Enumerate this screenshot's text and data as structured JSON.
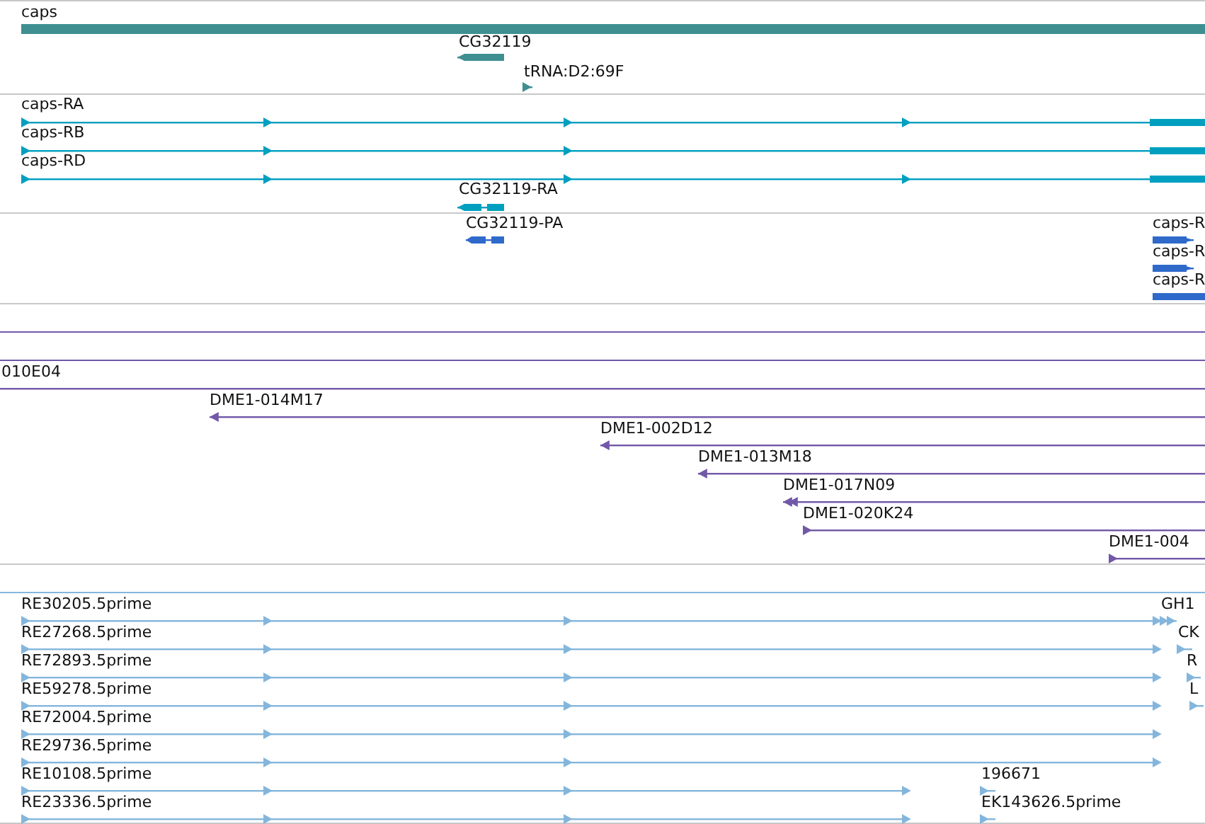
{
  "tracks": [
    {
      "kind": "gene",
      "features": [
        {
          "label": "caps"
        },
        {
          "label": "CG32119",
          "reverse": true
        },
        {
          "label": "tRNA:D2:69F",
          "reverse": false
        }
      ]
    },
    {
      "kind": "transcript",
      "features": [
        {
          "label": "caps-RA",
          "reverse": false
        },
        {
          "label": "caps-RB",
          "reverse": false
        },
        {
          "label": "caps-RD",
          "reverse": false
        },
        {
          "label": "CG32119-RA",
          "reverse": true
        }
      ]
    },
    {
      "kind": "protein",
      "features": [
        {
          "label": "CG32119-PA",
          "reverse": true
        },
        {
          "label": "caps-R",
          "reverse": false
        },
        {
          "label": "caps-R",
          "reverse": false
        },
        {
          "label": "caps-R"
        }
      ]
    },
    {
      "kind": "clone",
      "features": [
        {
          "label": "010E04"
        },
        {
          "label": "DME1-014M17",
          "reverse": true
        },
        {
          "label": "DME1-002D12",
          "reverse": true
        },
        {
          "label": "DME1-013M18",
          "reverse": true
        },
        {
          "label": "DME1-017N09",
          "reverse": true
        },
        {
          "label": "DME1-020K24",
          "reverse": false
        },
        {
          "label": "DME1-004",
          "reverse": false
        }
      ]
    },
    {
      "kind": "est",
      "features": [
        {
          "label": "RE30205.5prime",
          "reverse": false
        },
        {
          "label": "RE27268.5prime",
          "reverse": false
        },
        {
          "label": "RE72893.5prime",
          "reverse": false
        },
        {
          "label": "RE59278.5prime",
          "reverse": false
        },
        {
          "label": "RE72004.5prime",
          "reverse": false
        },
        {
          "label": "RE29736.5prime",
          "reverse": false
        },
        {
          "label": "RE10108.5prime",
          "reverse": false
        },
        {
          "label": "RE23336.5prime",
          "reverse": false
        },
        {
          "label": "GH1",
          "reverse": false
        },
        {
          "label": "CK",
          "reverse": false
        },
        {
          "label": "R",
          "reverse": false
        },
        {
          "label": "L",
          "reverse": false
        },
        {
          "label": "196671",
          "reverse": false
        },
        {
          "label": "EK143626.5prime",
          "reverse": false
        }
      ]
    }
  ]
}
